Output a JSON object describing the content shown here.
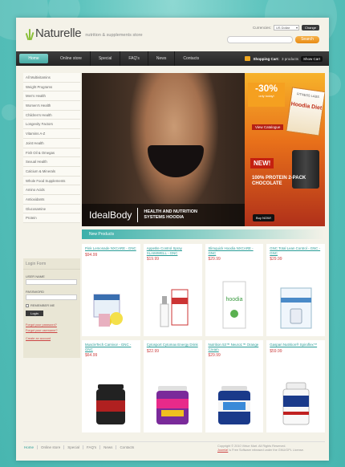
{
  "header": {
    "logo": "Naturelle",
    "tagline": "nutrition & supplements store",
    "currency_label": "Currencies:",
    "currency_value": "US Dollar",
    "change_button": "Change",
    "search_button": "Search"
  },
  "nav": {
    "items": [
      "Home",
      "Online store",
      "Special",
      "FAQ's",
      "News",
      "Contacts"
    ],
    "cart_label": "Shopping Cart:",
    "cart_count": "3 products",
    "show_cart": "Show Cart"
  },
  "sidebar": {
    "categories": [
      "All Multivitamins",
      "Weight Programs",
      "Men's Health",
      "Women's Health",
      "Children's Health",
      "Longevity Factors",
      "Vitamins A-Z",
      "Joint Health",
      "Fish Oil & Omegas",
      "Sexual Health",
      "Calcium & Minerals",
      "Whole Food Supplements",
      "Amino Acids",
      "Antioxidants",
      "Glucosamine",
      "Protein"
    ]
  },
  "login": {
    "title": "Login Form",
    "username_label": "USER NAME",
    "password_label": "PASSWORD",
    "remember_label": "REMEMBER ME",
    "login_button": "Login",
    "forgot_password": "Forgot your password?",
    "forgot_username": "Forgot your username?",
    "create_account": "Create an account"
  },
  "banner": {
    "caption_big": "IdealBody",
    "caption_small_1": "HEALTH AND NUTRITION",
    "caption_small_2": "SYSTEMS HOODIA",
    "discount": "-30%",
    "discount_sub": "only today!",
    "view_catalogue": "View Catalogue",
    "box_title": "Hoodia Diet",
    "box_sub": "FITNESS LABS",
    "new_badge": "NEW!",
    "promo_line1": "100% PROTEIN 2-PACK",
    "promo_line2": "CHOCOLATE",
    "buy_now": "Buy NOW!"
  },
  "section": {
    "new_products": "New Products"
  },
  "products": [
    {
      "title": "Pink Lemonade NXCARE - GNC",
      "price": "$94.99"
    },
    {
      "title": "Appetite Control Spray XLAIMWELL - GNC",
      "price": "$19.99"
    },
    {
      "title": "Slimquick Hoodia NXCARE - GNC",
      "price": "$29.99"
    },
    {
      "title": "GNC Total Lean Control - GNC - GNC",
      "price": "$29.99"
    },
    {
      "title": "MuscleTech Carnivor - GNC - GNC",
      "price": "$64.99"
    },
    {
      "title": "Cytosport Cytomax Energy Drink",
      "price": "$22.99"
    },
    {
      "title": "Nutrition 53™ Neuro1™ Orange Cream",
      "price": "$29.99"
    },
    {
      "title": "Gaspari Nutrition® Spiroflex™",
      "price": "$59.99"
    }
  ],
  "footer": {
    "nav": [
      "Home",
      "Online store",
      "Special",
      "FAQ's",
      "News",
      "Contacts"
    ],
    "copyright_1": "Copyright © 2010 Virtue Mart. All Rights Reserved.",
    "copyright_link": "Joomla!",
    "copyright_2": " is Free Software released under the GNU/GPL License."
  }
}
